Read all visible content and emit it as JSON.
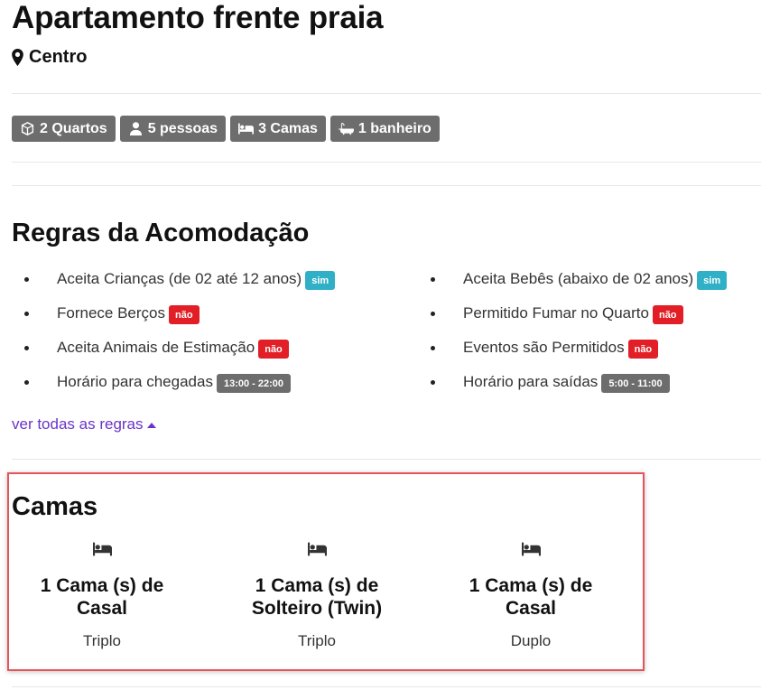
{
  "property": {
    "title": "Apartamento frente praia",
    "location": "Centro"
  },
  "features": [
    {
      "icon": "cube-icon",
      "label": "2 Quartos"
    },
    {
      "icon": "user-icon",
      "label": "5 pessoas"
    },
    {
      "icon": "bed-icon",
      "label": "3 Camas"
    },
    {
      "icon": "bathtub-icon",
      "label": "1 banheiro"
    }
  ],
  "rules": {
    "title": "Regras da Acomodação",
    "left": [
      {
        "label": "Aceita Crianças (de 02 até 12 anos)",
        "value": "sim",
        "kind": "yes"
      },
      {
        "label": "Fornece Berços",
        "value": "não",
        "kind": "no"
      },
      {
        "label": "Aceita Animais de Estimação",
        "value": "não",
        "kind": "no"
      },
      {
        "label": "Horário para chegadas",
        "value": "13:00 - 22:00",
        "kind": "time"
      }
    ],
    "right": [
      {
        "label": "Aceita Bebês (abaixo de 02 anos)",
        "value": "sim",
        "kind": "yes"
      },
      {
        "label": "Permitido Fumar no Quarto",
        "value": "não",
        "kind": "no"
      },
      {
        "label": "Eventos são Permitidos",
        "value": "não",
        "kind": "no"
      },
      {
        "label": "Horário para saídas",
        "value": "5:00 - 11:00",
        "kind": "time"
      }
    ],
    "more_link": "ver todas as regras"
  },
  "beds": {
    "title": "Camas",
    "items": [
      {
        "name_line1": "1 Cama (s) de",
        "name_line2": "Casal",
        "room": "Triplo"
      },
      {
        "name_line1": "1 Cama (s) de",
        "name_line2": "Solteiro (Twin)",
        "room": "Triplo"
      },
      {
        "name_line1": "1 Cama (s) de",
        "name_line2": "Casal",
        "room": "Duplo"
      }
    ]
  },
  "colors": {
    "badge_yes": "#2fb0c6",
    "badge_no": "#e21f26",
    "badge_neutral": "#6d6d6d",
    "link": "#6a34c8",
    "highlight_border": "#e5545a"
  }
}
